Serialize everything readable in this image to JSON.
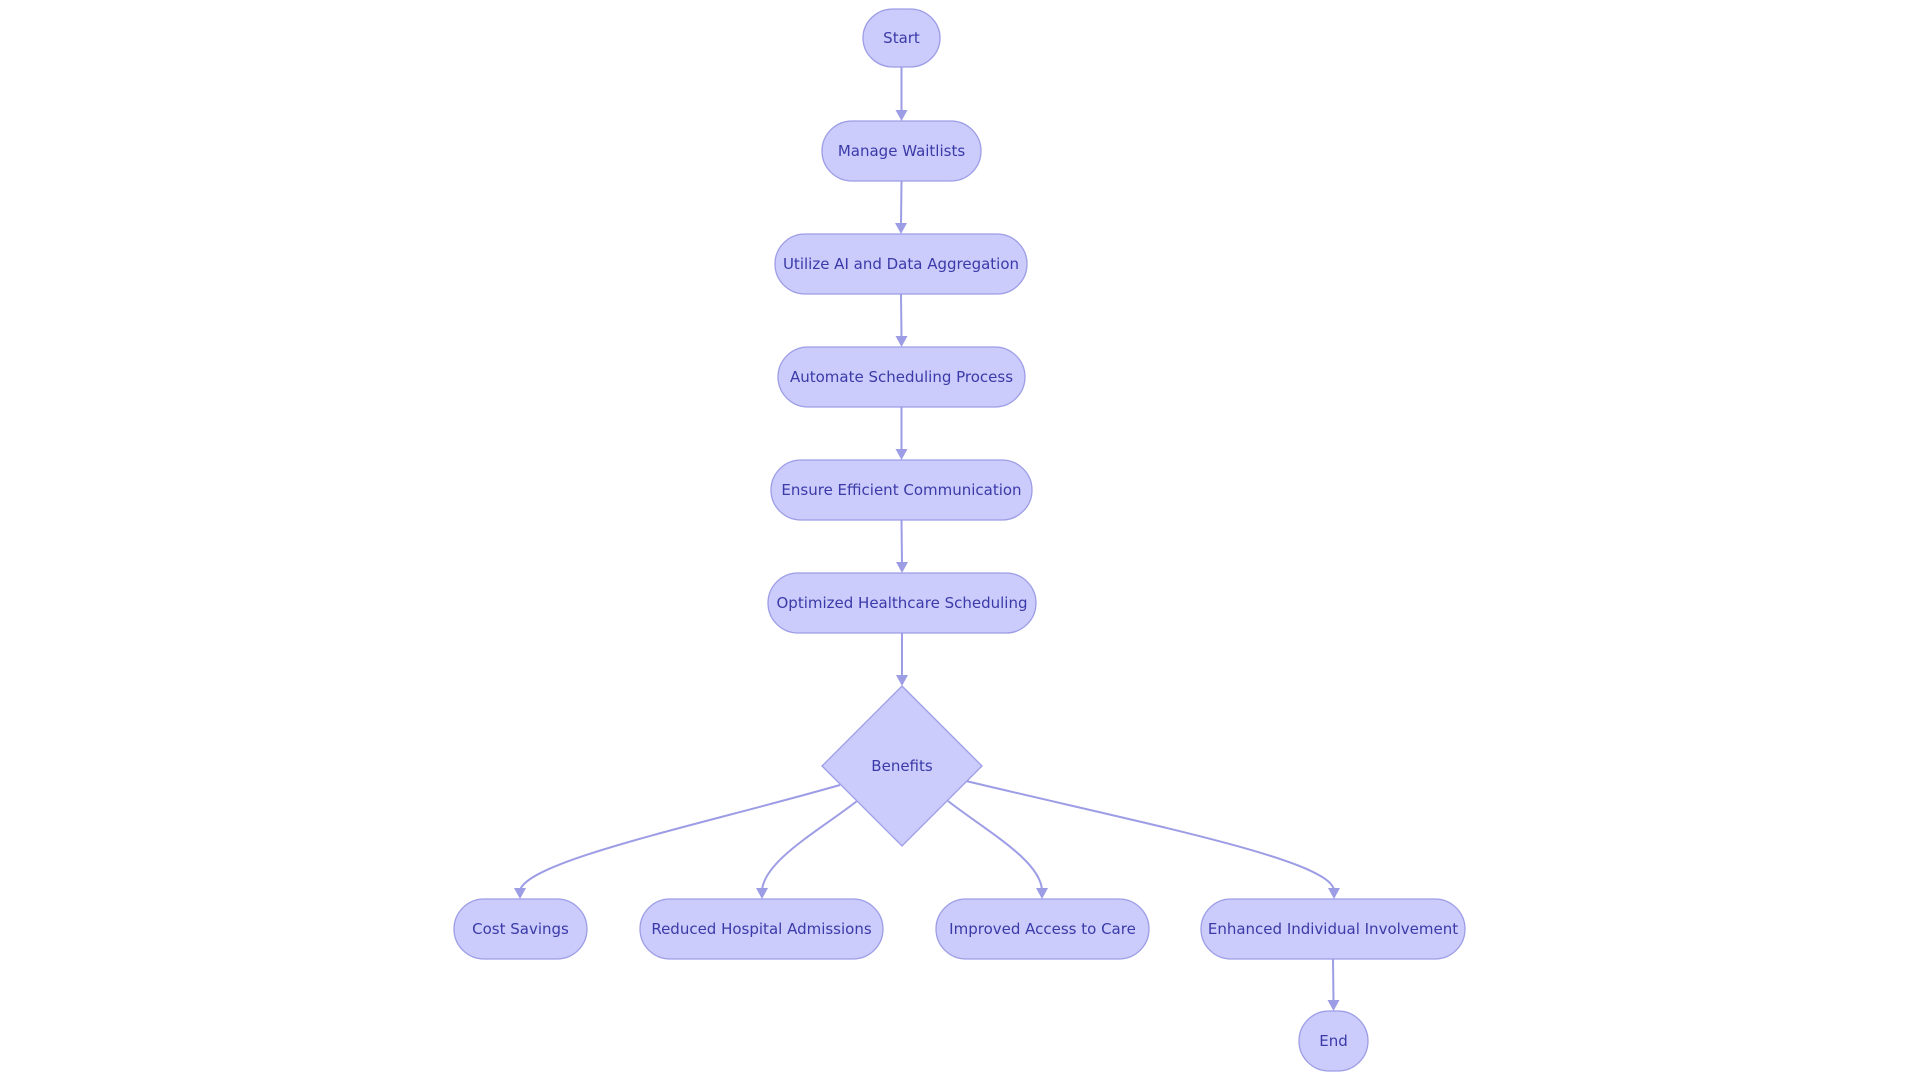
{
  "diagram": {
    "type": "flowchart",
    "direction": "top-down",
    "colors": {
      "node_fill": "#cbcbfc",
      "node_stroke": "#9d9de6",
      "text": "#3a3aa8",
      "edge": "#9d9de6"
    },
    "nodes": [
      {
        "id": "start",
        "label": "Start",
        "shape": "rounded"
      },
      {
        "id": "manage",
        "label": "Manage Waitlists",
        "shape": "rounded"
      },
      {
        "id": "utilize",
        "label": "Utilize AI and Data Aggregation",
        "shape": "rounded"
      },
      {
        "id": "automate",
        "label": "Automate Scheduling Process",
        "shape": "rounded"
      },
      {
        "id": "ensure",
        "label": "Ensure Efficient Communication",
        "shape": "rounded"
      },
      {
        "id": "optimized",
        "label": "Optimized Healthcare Scheduling",
        "shape": "rounded"
      },
      {
        "id": "benefits",
        "label": "Benefits",
        "shape": "diamond"
      },
      {
        "id": "cost",
        "label": "Cost Savings",
        "shape": "rounded"
      },
      {
        "id": "reduced",
        "label": "Reduced Hospital Admissions",
        "shape": "rounded"
      },
      {
        "id": "improved",
        "label": "Improved Access to Care",
        "shape": "rounded"
      },
      {
        "id": "enhanced",
        "label": "Enhanced Individual Involvement",
        "shape": "rounded"
      },
      {
        "id": "end",
        "label": "End",
        "shape": "rounded"
      }
    ],
    "edges": [
      {
        "from": "start",
        "to": "manage"
      },
      {
        "from": "manage",
        "to": "utilize"
      },
      {
        "from": "utilize",
        "to": "automate"
      },
      {
        "from": "automate",
        "to": "ensure"
      },
      {
        "from": "ensure",
        "to": "optimized"
      },
      {
        "from": "optimized",
        "to": "benefits"
      },
      {
        "from": "benefits",
        "to": "cost"
      },
      {
        "from": "benefits",
        "to": "reduced"
      },
      {
        "from": "benefits",
        "to": "improved"
      },
      {
        "from": "benefits",
        "to": "enhanced"
      },
      {
        "from": "enhanced",
        "to": "end"
      }
    ]
  }
}
